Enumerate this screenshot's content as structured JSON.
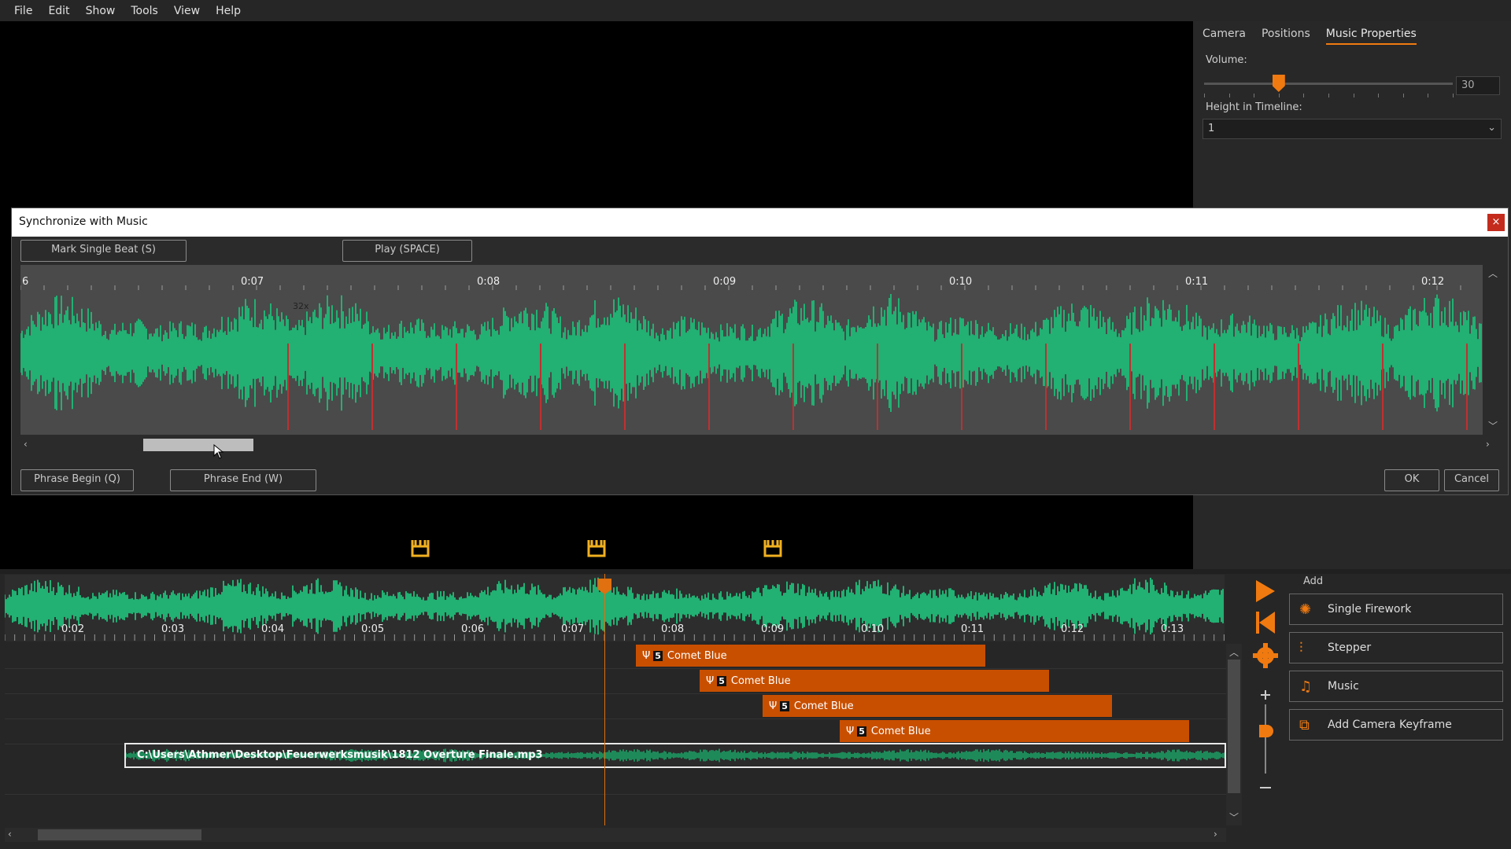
{
  "menu": [
    "File",
    "Edit",
    "Show",
    "Tools",
    "View",
    "Help"
  ],
  "properties": {
    "tabs": [
      "Camera",
      "Positions",
      "Music Properties"
    ],
    "volume_label": "Volume:",
    "volume_value": "30",
    "volume_fraction": 0.3,
    "height_label": "Height in Timeline:",
    "height_value": "1"
  },
  "dialog": {
    "title": "Synchronize with Music",
    "close": "×",
    "mark_beat": "Mark Single Beat (S)",
    "play": "Play (SPACE)",
    "phrase_begin": "Phrase Begin (Q)",
    "phrase_end": "Phrase End (W)",
    "ok": "OK",
    "cancel": "Cancel",
    "zoom_label": "32x",
    "time_labels": [
      "6",
      "0:07",
      "0:08",
      "0:09",
      "0:10",
      "0:11",
      "0:12"
    ]
  },
  "timeline": {
    "time_labels": [
      "0:02",
      "0:03",
      "0:04",
      "0:05",
      "0:06",
      "0:07",
      "0:08",
      "0:09",
      "0:10",
      "0:11",
      "0:12",
      "0:13"
    ],
    "firework_count": "5",
    "firework_name": "Comet Blue",
    "music_path": "C:\\Users\\Athmer\\Desktop\\Feuerwerksmusik\\1812 Overture Finale.mp3"
  },
  "add_panel": {
    "title": "Add",
    "buttons": [
      "Single Firework",
      "Stepper",
      "Music",
      "Add Camera Keyframe"
    ]
  },
  "colors": {
    "accent": "#f07a10",
    "wave": "#22b073",
    "firework_block": "#c84f00",
    "beat_marker": "#c03030"
  }
}
